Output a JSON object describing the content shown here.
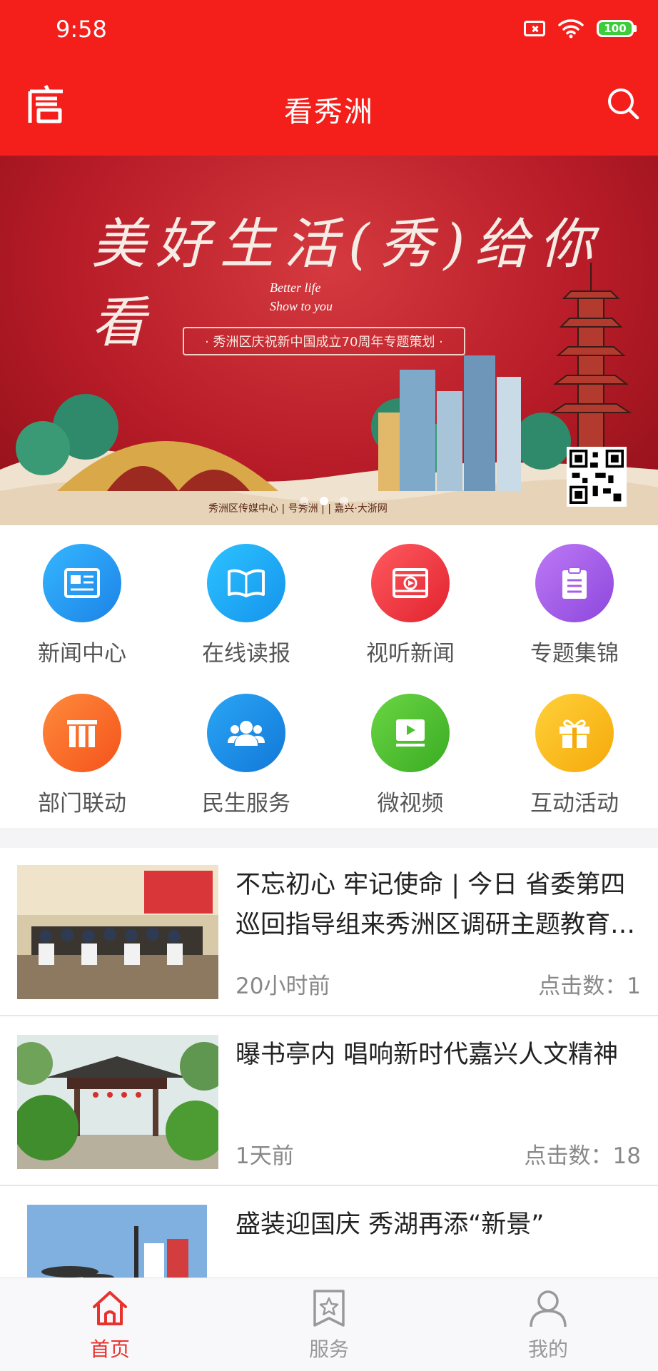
{
  "status_bar": {
    "time": "9:58",
    "battery": "100"
  },
  "header": {
    "title": "看秀洲"
  },
  "banner": {
    "title": "美好生活(秀)给你看",
    "subtitle_line1": "Better life",
    "subtitle_line2": "Show to you",
    "ribbon": "· 秀洲区庆祝新中国成立70周年专题策划 ·",
    "credit": "秀洲区传媒中心 | 号秀洲 | | 嘉兴·大浙网"
  },
  "grid": [
    {
      "label": "新闻中心",
      "icon": "newspaper-icon",
      "color": "#1f9cf3"
    },
    {
      "label": "在线读报",
      "icon": "book-icon",
      "color": "#1aa6f6"
    },
    {
      "label": "视听新闻",
      "icon": "film-play-icon",
      "color": "#f0323f"
    },
    {
      "label": "专题集锦",
      "icon": "clipboard-icon",
      "color": "#a65ee9"
    },
    {
      "label": "部门联动",
      "icon": "pillars-icon",
      "color": "#fb6a25"
    },
    {
      "label": "民生服务",
      "icon": "people-icon",
      "color": "#1a8fe8"
    },
    {
      "label": "微视频",
      "icon": "video-icon",
      "color": "#4cc22e"
    },
    {
      "label": "互动活动",
      "icon": "gift-icon",
      "color": "#fdbb16"
    }
  ],
  "news": [
    {
      "title": "不忘初心 牢记使命 | 今日 省委第四巡回指导组来秀洲区调研主题教育工作",
      "time": "20小时前",
      "clicks": "点击数：1"
    },
    {
      "title": "曝书亭内 唱响新时代嘉兴人文精神",
      "time": "1天前",
      "clicks": "点击数：18"
    },
    {
      "title": "盛装迎国庆 秀湖再添“新景”",
      "time": "",
      "clicks": ""
    }
  ],
  "tabs": [
    {
      "label": "首页",
      "icon": "home-icon"
    },
    {
      "label": "服务",
      "icon": "star-icon"
    },
    {
      "label": "我的",
      "icon": "user-icon"
    }
  ]
}
